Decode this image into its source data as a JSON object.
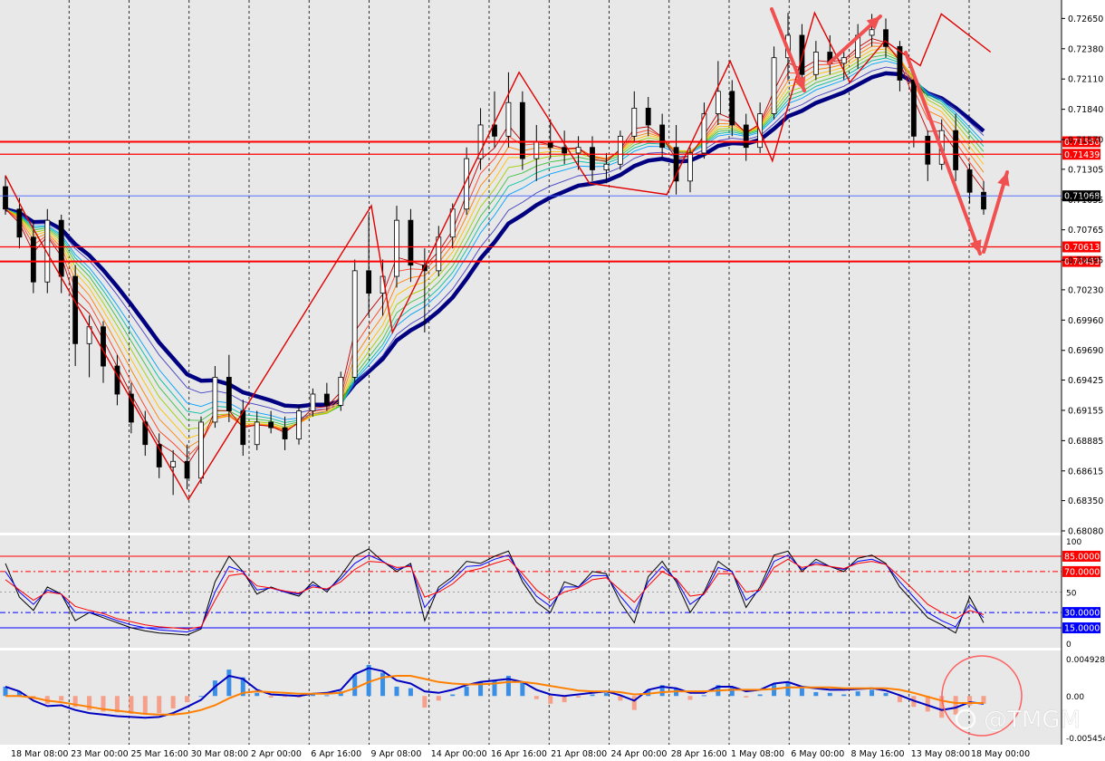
{
  "chart_data": [
    {
      "type": "candlestick",
      "title": "",
      "price_ticks": [
        "0.72650",
        "0.72380",
        "0.72110",
        "0.71840",
        "0.71570",
        "0.71305",
        "0.71035",
        "0.70765",
        "0.70495",
        "0.70230",
        "0.69960",
        "0.69690",
        "0.69425",
        "0.69155",
        "0.68885",
        "0.68615",
        "0.68350",
        "0.68080"
      ],
      "ylim": [
        0.6808,
        0.7275
      ],
      "horizontal_levels": [
        {
          "label": "0.71550",
          "value": 0.7155,
          "color": "#ff0000"
        },
        {
          "label": "0.71439",
          "value": 0.71439,
          "color": "#ff0000"
        },
        {
          "label": "0.70613",
          "value": 0.70613,
          "color": "#ff0000"
        },
        {
          "label": "0.70483",
          "value": 0.70483,
          "color": "#ff0000"
        }
      ],
      "current_price": {
        "label": "0.71068",
        "value": 0.71068,
        "color": "#000000"
      },
      "time_labels": [
        "18 Mar 08:00",
        "23 Mar 00:00",
        "25 Mar 16:00",
        "30 Mar 08:00",
        "2 Apr 00:00",
        "6 Apr 16:00",
        "9 Apr 08:00",
        "14 Apr 00:00",
        "16 Apr 16:00",
        "21 Apr 08:00",
        "24 Apr 00:00",
        "28 Apr 16:00",
        "1 May 08:00",
        "6 May 00:00",
        "8 May 16:00",
        "13 May 08:00",
        "18 May 00:00"
      ],
      "zigzag": [
        [
          0,
          0.7125
        ],
        [
          3,
          0.7088
        ],
        [
          26,
          0.6836
        ],
        [
          52,
          0.7098
        ],
        [
          55,
          0.6985
        ],
        [
          73,
          0.7217
        ],
        [
          83,
          0.7118
        ],
        [
          94,
          0.7108
        ],
        [
          103,
          0.7227
        ],
        [
          109,
          0.7138
        ],
        [
          115,
          0.727
        ],
        [
          120,
          0.7208
        ],
        [
          125,
          0.7245
        ],
        [
          130,
          0.7223
        ],
        [
          133,
          0.7269
        ],
        [
          140,
          0.7235
        ]
      ],
      "candles": [
        [
          0,
          0.7115,
          0.7125,
          0.709,
          0.7095
        ],
        [
          1,
          0.7095,
          0.7105,
          0.706,
          0.707
        ],
        [
          2,
          0.707,
          0.7085,
          0.702,
          0.703
        ],
        [
          3,
          0.703,
          0.7095,
          0.702,
          0.7085
        ],
        [
          4,
          0.7085,
          0.709,
          0.702,
          0.7035
        ],
        [
          5,
          0.7035,
          0.7045,
          0.6955,
          0.6975
        ],
        [
          6,
          0.6975,
          0.7,
          0.6945,
          0.699
        ],
        [
          7,
          0.699,
          0.6995,
          0.694,
          0.6955
        ],
        [
          8,
          0.6955,
          0.6965,
          0.692,
          0.693
        ],
        [
          9,
          0.693,
          0.694,
          0.6895,
          0.6905
        ],
        [
          10,
          0.6905,
          0.6915,
          0.6875,
          0.6885
        ],
        [
          11,
          0.6885,
          0.6895,
          0.6855,
          0.6865
        ],
        [
          12,
          0.6865,
          0.688,
          0.684,
          0.687
        ],
        [
          13,
          0.687,
          0.6885,
          0.6845,
          0.6855
        ],
        [
          14,
          0.6855,
          0.691,
          0.685,
          0.6905
        ],
        [
          15,
          0.6905,
          0.6955,
          0.69,
          0.6945
        ],
        [
          16,
          0.6945,
          0.6965,
          0.6905,
          0.6915
        ],
        [
          17,
          0.6915,
          0.6925,
          0.6875,
          0.6885
        ],
        [
          18,
          0.6885,
          0.6915,
          0.688,
          0.6905
        ],
        [
          19,
          0.6905,
          0.6915,
          0.6895,
          0.69
        ],
        [
          20,
          0.69,
          0.691,
          0.688,
          0.689
        ],
        [
          21,
          0.689,
          0.692,
          0.6885,
          0.6915
        ],
        [
          22,
          0.6915,
          0.6935,
          0.691,
          0.693
        ],
        [
          23,
          0.693,
          0.694,
          0.6915,
          0.692
        ],
        [
          24,
          0.692,
          0.695,
          0.6915,
          0.6945
        ],
        [
          25,
          0.6945,
          0.705,
          0.694,
          0.704
        ],
        [
          26,
          0.704,
          0.709,
          0.7,
          0.702
        ],
        [
          27,
          0.702,
          0.705,
          0.7,
          0.7035
        ],
        [
          28,
          0.7035,
          0.7098,
          0.7025,
          0.7085
        ],
        [
          29,
          0.7085,
          0.7095,
          0.703,
          0.7045
        ],
        [
          30,
          0.7045,
          0.706,
          0.6985,
          0.704
        ],
        [
          31,
          0.704,
          0.708,
          0.7035,
          0.707
        ],
        [
          32,
          0.707,
          0.71,
          0.706,
          0.7095
        ],
        [
          33,
          0.7095,
          0.715,
          0.709,
          0.714
        ],
        [
          34,
          0.714,
          0.7185,
          0.713,
          0.717
        ],
        [
          35,
          0.717,
          0.72,
          0.715,
          0.716
        ],
        [
          36,
          0.716,
          0.7217,
          0.715,
          0.719
        ],
        [
          37,
          0.719,
          0.72,
          0.713,
          0.714
        ],
        [
          38,
          0.714,
          0.717,
          0.712,
          0.7155
        ],
        [
          39,
          0.7155,
          0.7175,
          0.714,
          0.715
        ],
        [
          40,
          0.715,
          0.7165,
          0.7135,
          0.7145
        ],
        [
          41,
          0.7145,
          0.716,
          0.713,
          0.715
        ],
        [
          42,
          0.715,
          0.716,
          0.712,
          0.713
        ],
        [
          43,
          0.713,
          0.7145,
          0.7118,
          0.7135
        ],
        [
          44,
          0.7135,
          0.7165,
          0.713,
          0.716
        ],
        [
          45,
          0.716,
          0.72,
          0.7155,
          0.7185
        ],
        [
          46,
          0.7185,
          0.7195,
          0.716,
          0.717
        ],
        [
          47,
          0.717,
          0.718,
          0.714,
          0.715
        ],
        [
          48,
          0.715,
          0.717,
          0.7108,
          0.712
        ],
        [
          49,
          0.712,
          0.715,
          0.711,
          0.7145
        ],
        [
          50,
          0.7145,
          0.719,
          0.714,
          0.718
        ],
        [
          51,
          0.718,
          0.7227,
          0.717,
          0.72
        ],
        [
          52,
          0.72,
          0.721,
          0.716,
          0.717
        ],
        [
          53,
          0.717,
          0.718,
          0.7138,
          0.715
        ],
        [
          54,
          0.715,
          0.719,
          0.7145,
          0.718
        ],
        [
          55,
          0.718,
          0.724,
          0.7175,
          0.723
        ],
        [
          56,
          0.723,
          0.727,
          0.721,
          0.725
        ],
        [
          57,
          0.725,
          0.726,
          0.7205,
          0.7215
        ],
        [
          58,
          0.7215,
          0.7245,
          0.721,
          0.7235
        ],
        [
          59,
          0.7235,
          0.725,
          0.7215,
          0.7225
        ],
        [
          60,
          0.7225,
          0.7235,
          0.721,
          0.723
        ],
        [
          61,
          0.723,
          0.726,
          0.722,
          0.725
        ],
        [
          62,
          0.725,
          0.7269,
          0.724,
          0.7255
        ],
        [
          63,
          0.7255,
          0.7265,
          0.723,
          0.724
        ],
        [
          64,
          0.724,
          0.7245,
          0.72,
          0.721
        ],
        [
          65,
          0.721,
          0.7215,
          0.715,
          0.716
        ],
        [
          66,
          0.716,
          0.7165,
          0.712,
          0.7135
        ],
        [
          67,
          0.7135,
          0.7175,
          0.713,
          0.7165
        ],
        [
          68,
          0.7165,
          0.718,
          0.712,
          0.713
        ],
        [
          69,
          0.713,
          0.7135,
          0.71,
          0.711
        ],
        [
          70,
          0.711,
          0.712,
          0.709,
          0.7095
        ]
      ],
      "ribbon_colors": [
        "#000080",
        "#4040c0",
        "#00a0ff",
        "#00c0a0",
        "#40c040",
        "#a0d000",
        "#ffc000",
        "#ff8000",
        "#ff4020",
        "#c00000"
      ]
    },
    {
      "type": "line",
      "name": "stochastic",
      "ylim": [
        0,
        100
      ],
      "tick_labels": [
        "100",
        "50",
        "0"
      ],
      "levels": [
        {
          "label": "85.0000",
          "value": 85,
          "color": "#ff0000"
        },
        {
          "label": "70.0000",
          "value": 70,
          "color": "#ff0000"
        },
        {
          "label": "30.0000",
          "value": 30,
          "color": "#0000ff"
        },
        {
          "label": "15.0000",
          "value": 15,
          "color": "#0000ff"
        }
      ],
      "series": [
        {
          "color": "#000000",
          "values": [
            78,
            45,
            32,
            55,
            48,
            22,
            30,
            25,
            20,
            15,
            12,
            10,
            9,
            8,
            14,
            60,
            85,
            70,
            48,
            55,
            50,
            46,
            60,
            50,
            66,
            85,
            92,
            80,
            70,
            78,
            22,
            55,
            65,
            80,
            78,
            85,
            90,
            60,
            40,
            30,
            60,
            55,
            70,
            68,
            40,
            20,
            65,
            80,
            60,
            30,
            50,
            80,
            70,
            35,
            55,
            86,
            90,
            70,
            82,
            75,
            70,
            83,
            86,
            78,
            55,
            40,
            25,
            18,
            10,
            45,
            20
          ]
        },
        {
          "color": "#0000ff",
          "values": [
            70,
            50,
            38,
            52,
            48,
            30,
            30,
            27,
            22,
            18,
            15,
            13,
            12,
            11,
            15,
            50,
            75,
            70,
            52,
            54,
            50,
            48,
            57,
            52,
            63,
            78,
            86,
            80,
            72,
            76,
            35,
            52,
            62,
            75,
            76,
            82,
            86,
            64,
            46,
            36,
            55,
            55,
            66,
            66,
            46,
            30,
            60,
            75,
            62,
            38,
            48,
            74,
            70,
            42,
            52,
            80,
            86,
            72,
            79,
            75,
            72,
            80,
            82,
            77,
            60,
            45,
            30,
            22,
            16,
            38,
            25
          ]
        },
        {
          "color": "#ff0000",
          "values": [
            62,
            52,
            42,
            50,
            48,
            36,
            32,
            29,
            24,
            21,
            18,
            16,
            15,
            14,
            16,
            42,
            66,
            68,
            56,
            54,
            51,
            49,
            55,
            53,
            60,
            72,
            80,
            79,
            74,
            75,
            45,
            50,
            58,
            70,
            73,
            78,
            82,
            68,
            52,
            42,
            50,
            54,
            62,
            64,
            52,
            40,
            56,
            70,
            63,
            46,
            48,
            68,
            68,
            50,
            52,
            74,
            82,
            74,
            77,
            75,
            73,
            78,
            80,
            77,
            65,
            52,
            38,
            30,
            24,
            32,
            28
          ]
        }
      ]
    },
    {
      "type": "bar",
      "name": "macd",
      "ylim": [
        -0.005454,
        0.0049282
      ],
      "tick_labels": [
        "0.0049282",
        "0.00",
        "-0.005454"
      ],
      "histogram": [
        0.0012,
        0.0006,
        -0.0004,
        -0.001,
        -0.0006,
        -0.0014,
        -0.0018,
        -0.002,
        -0.0021,
        -0.0023,
        -0.0024,
        -0.0022,
        -0.0016,
        -0.0008,
        0.0,
        0.002,
        0.0034,
        0.0024,
        0.0004,
        -0.0002,
        -0.0001,
        -0.0002,
        0.0002,
        0.0001,
        0.0006,
        0.0028,
        0.004,
        0.003,
        0.0012,
        0.001,
        -0.0015,
        -0.0006,
        0.0002,
        0.0012,
        0.0018,
        0.002,
        0.0026,
        0.0018,
        -0.0004,
        -0.001,
        -0.0008,
        -0.0002,
        0.0002,
        0.0004,
        -0.0006,
        -0.0018,
        0.0008,
        0.0014,
        0.001,
        -0.0005,
        0.0001,
        0.0014,
        0.0012,
        -0.0002,
        0.0002,
        0.0016,
        0.0018,
        0.001,
        0.0005,
        0.0004,
        0.0002,
        0.0006,
        0.0008,
        0.0004,
        -0.0008,
        -0.0014,
        -0.002,
        -0.0028,
        -0.0024,
        -0.0012,
        -0.001
      ],
      "series": [
        {
          "color": "#0000c0",
          "values": [
            0.0012,
            0.0006,
            -0.0006,
            -0.0013,
            -0.0012,
            -0.0018,
            -0.0022,
            -0.0024,
            -0.0026,
            -0.0027,
            -0.0028,
            -0.0027,
            -0.0022,
            -0.0014,
            -0.0005,
            0.0012,
            0.0026,
            0.0022,
            0.0008,
            0.0002,
            0.0001,
            0.0,
            0.0003,
            0.0004,
            0.0008,
            0.0028,
            0.0036,
            0.0032,
            0.002,
            0.0016,
            0.0006,
            0.0004,
            0.0008,
            0.0014,
            0.0018,
            0.002,
            0.0022,
            0.0018,
            0.0008,
            0.0002,
            0.0,
            0.0002,
            0.0004,
            0.0006,
            0.0001,
            -0.0006,
            0.0008,
            0.0012,
            0.001,
            0.0004,
            0.0004,
            0.0012,
            0.0012,
            0.0006,
            0.0008,
            0.0016,
            0.0018,
            0.0012,
            0.001,
            0.0008,
            0.0008,
            0.0009,
            0.001,
            0.0007,
            0.0001,
            -0.0006,
            -0.0012,
            -0.0018,
            -0.0015,
            -0.0008,
            -0.001
          ]
        },
        {
          "color": "#ff8000",
          "values": [
            0.0,
            0.0,
            -0.0002,
            -0.0006,
            -0.0008,
            -0.0011,
            -0.0014,
            -0.0017,
            -0.0019,
            -0.0021,
            -0.0023,
            -0.0024,
            -0.0024,
            -0.0022,
            -0.0018,
            -0.0012,
            -0.0003,
            0.0004,
            0.0006,
            0.0005,
            0.0004,
            0.0003,
            0.0003,
            0.0003,
            0.0004,
            0.001,
            0.0018,
            0.0024,
            0.0026,
            0.0026,
            0.0022,
            0.0018,
            0.0016,
            0.0015,
            0.0015,
            0.0016,
            0.0018,
            0.0018,
            0.0016,
            0.0013,
            0.001,
            0.0007,
            0.0006,
            0.0006,
            0.0005,
            0.0002,
            0.0003,
            0.0005,
            0.0006,
            0.0006,
            0.0006,
            0.0007,
            0.0008,
            0.0008,
            0.0008,
            0.0009,
            0.0011,
            0.0011,
            0.0011,
            0.0011,
            0.001,
            0.001,
            0.001,
            0.001,
            0.0008,
            0.0004,
            -0.0001,
            -0.0006,
            -0.0009,
            -0.0009,
            -0.0009
          ]
        }
      ]
    }
  ],
  "watermark": "@TMGM"
}
